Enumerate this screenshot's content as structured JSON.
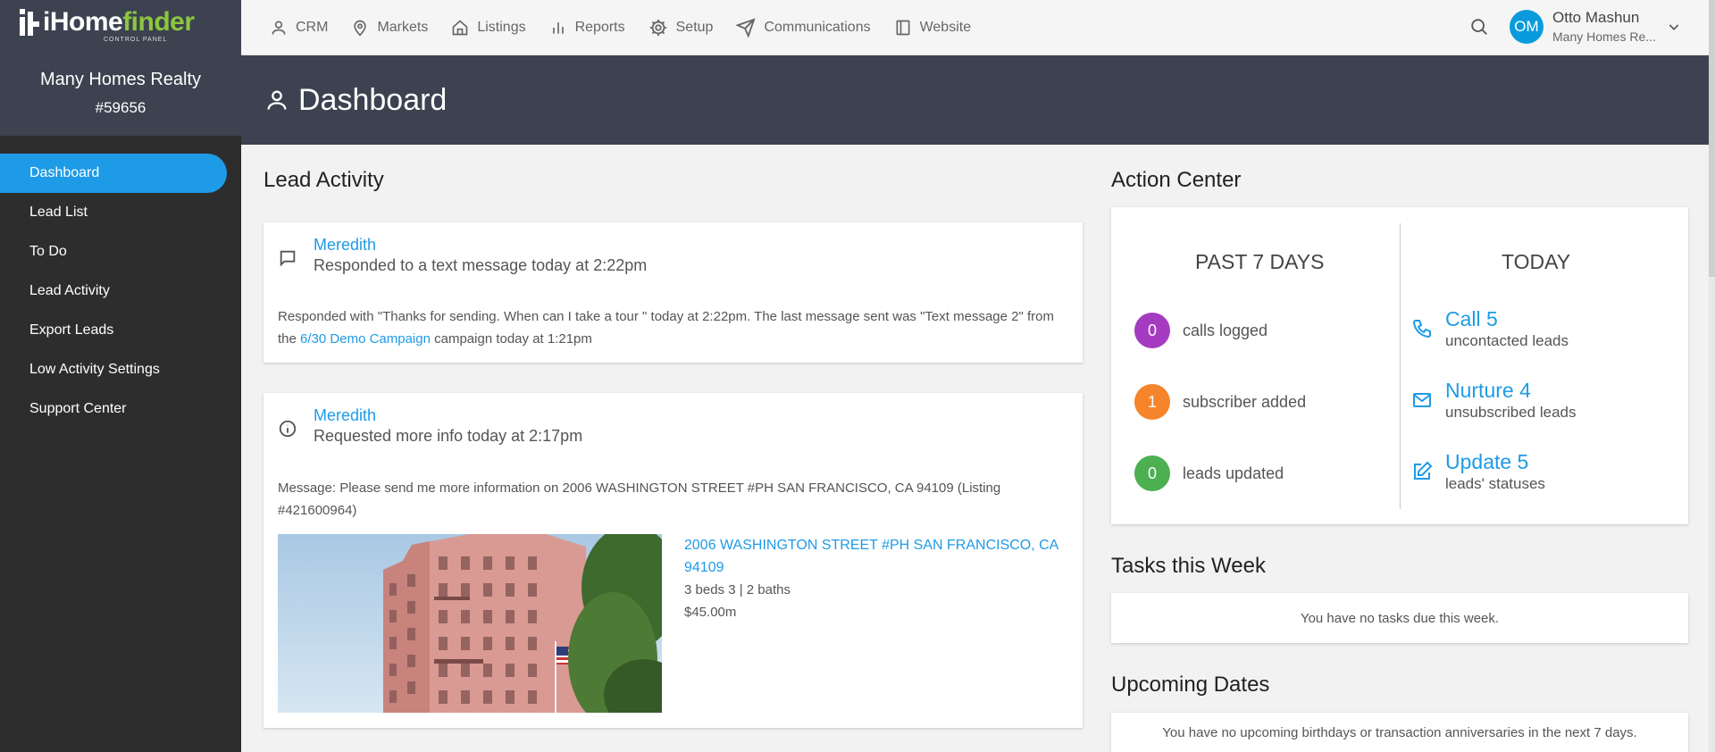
{
  "brand": {
    "logo_white": "iHome",
    "logo_green": "finder",
    "logo_sub": "CONTROL PANEL"
  },
  "account": {
    "name": "Many Homes Realty",
    "id": "#59656"
  },
  "sidebar": {
    "items": [
      {
        "label": "Dashboard",
        "active": true
      },
      {
        "label": "Lead List"
      },
      {
        "label": "To Do"
      },
      {
        "label": "Lead Activity"
      },
      {
        "label": "Export Leads"
      },
      {
        "label": "Low Activity Settings"
      },
      {
        "label": "Support Center"
      }
    ]
  },
  "topnav": {
    "items": [
      {
        "label": "CRM",
        "icon": "user-icon"
      },
      {
        "label": "Markets",
        "icon": "map-pin-icon"
      },
      {
        "label": "Listings",
        "icon": "home-icon"
      },
      {
        "label": "Reports",
        "icon": "bar-chart-icon"
      },
      {
        "label": "Setup",
        "icon": "gear-icon"
      },
      {
        "label": "Communications",
        "icon": "send-icon"
      },
      {
        "label": "Website",
        "icon": "layout-icon"
      }
    ]
  },
  "user": {
    "initials": "OM",
    "name": "Otto Mashun",
    "org": "Many Homes Re..."
  },
  "page": {
    "title": "Dashboard"
  },
  "lead_activity": {
    "title": "Lead Activity",
    "items": [
      {
        "name": "Meredith",
        "summary": "Responded to a text message today at 2:22pm",
        "body_before": "Responded with \"Thanks for sending. When can I take a tour \" today at 2:22pm. The last message sent was \"Text message 2\" from the ",
        "link": "6/30 Demo Campaign",
        "body_after": " campaign today at 1:21pm"
      },
      {
        "name": "Meredith",
        "summary": "Requested more info today at 2:17pm",
        "body": "Message: Please send me more information on 2006 WASHINGTON STREET #PH SAN FRANCISCO, CA 94109 (Listing #421600964)",
        "listing": {
          "address": "2006 WASHINGTON STREET #PH SAN FRANCISCO, CA 94109",
          "beds_baths": "3 beds  3 | 2 baths",
          "price": "$45.00m"
        }
      }
    ]
  },
  "action_center": {
    "title": "Action Center",
    "past_title": "PAST 7 DAYS",
    "today_title": "TODAY",
    "stats": [
      {
        "value": "0",
        "label": "calls logged",
        "color": "#a53bc1"
      },
      {
        "value": "1",
        "label": "subscriber added",
        "color": "#f5842a"
      },
      {
        "value": "0",
        "label": "leads updated",
        "color": "#4caf50"
      }
    ],
    "actions": [
      {
        "main": "Call 5",
        "sub": "uncontacted leads",
        "icon": "phone-icon"
      },
      {
        "main": "Nurture 4",
        "sub": "unsubscribed leads",
        "icon": "mail-icon"
      },
      {
        "main": "Update 5",
        "sub": "leads' statuses",
        "icon": "edit-icon"
      }
    ]
  },
  "tasks": {
    "title": "Tasks this Week",
    "empty": "You have no tasks due this week."
  },
  "upcoming": {
    "title": "Upcoming Dates",
    "empty": "You have no upcoming birthdays or transaction anniversaries in the next 7 days."
  }
}
